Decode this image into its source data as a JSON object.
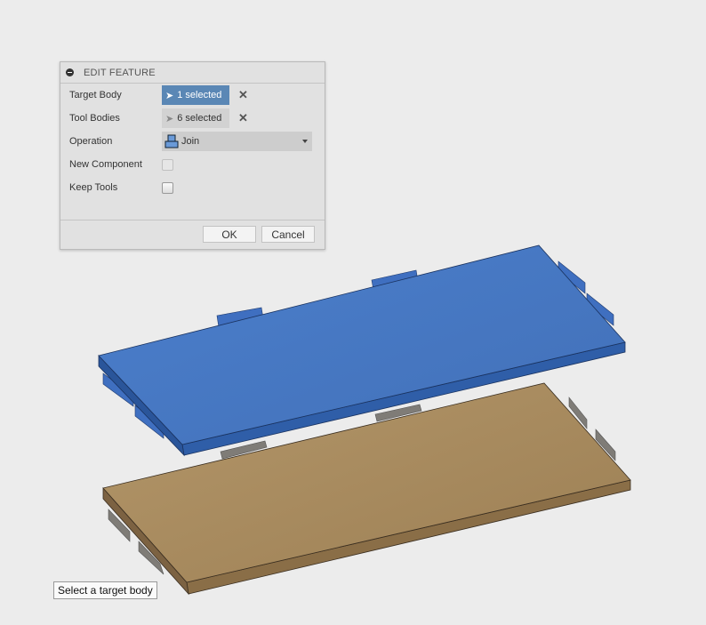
{
  "dialog": {
    "title": "EDIT FEATURE",
    "rows": {
      "target_body": {
        "label": "Target Body",
        "value": "1 selected"
      },
      "tool_bodies": {
        "label": "Tool Bodies",
        "value": "6 selected"
      },
      "operation": {
        "label": "Operation",
        "value": "Join"
      },
      "new_component": {
        "label": "New Component",
        "checked": false,
        "enabled": false
      },
      "keep_tools": {
        "label": "Keep Tools",
        "checked": false
      }
    },
    "ok_label": "OK",
    "cancel_label": "Cancel"
  },
  "tooltip": "Select a target body",
  "colors": {
    "selection_blue": "#5a87b5",
    "target_body": "#4a7cc7",
    "tool_body_wood": "#a98a5e",
    "tabs_gray": "#7d7a75"
  }
}
